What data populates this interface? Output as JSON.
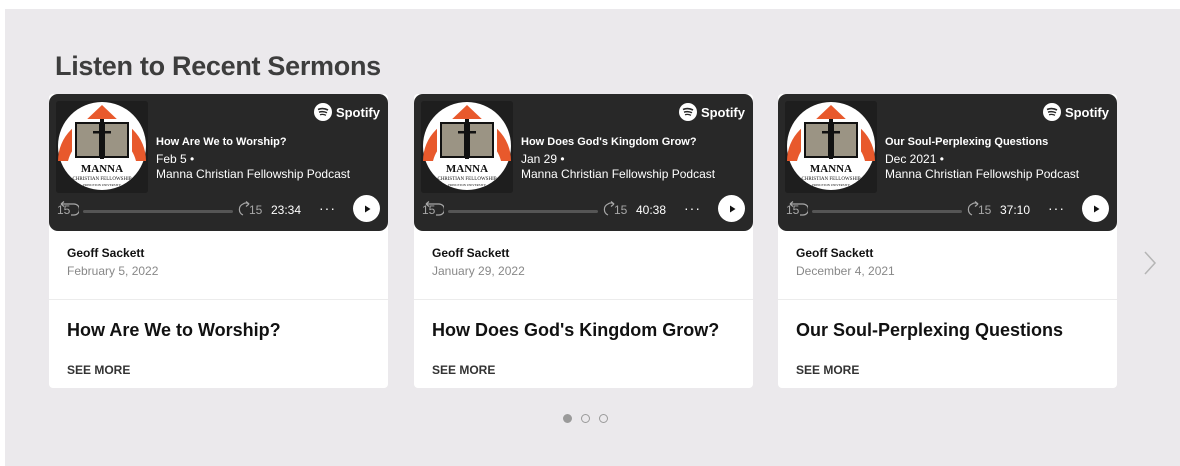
{
  "section": {
    "title": "Listen to Recent Sermons"
  },
  "cover_art": {
    "name_line": "MANNA",
    "sub_line": "CHRISTIAN FELLOWSHIP",
    "small_line": "PRINCETON UNIVERSITY",
    "colors": {
      "orange": "#e8592c",
      "book": "#9b9484"
    }
  },
  "spotify": {
    "label": "Spotify"
  },
  "cards": [
    {
      "player": {
        "episode_title": "How Are We to Worship?",
        "date": "Feb 5 •",
        "show": "Manna Christian Fellowship Podcast",
        "skip_back": "15",
        "skip_forward": "15",
        "duration": "23:34",
        "more": "···"
      },
      "author": "Geoff Sackett",
      "date": "February 5, 2022",
      "title": "How Are We to Worship?",
      "see_more": "SEE MORE"
    },
    {
      "player": {
        "episode_title": "How Does God's Kingdom Grow?",
        "date": "Jan 29 •",
        "show": "Manna Christian Fellowship Podcast",
        "skip_back": "15",
        "skip_forward": "15",
        "duration": "40:38",
        "more": "···"
      },
      "author": "Geoff Sackett",
      "date": "January 29, 2022",
      "title": "How Does God's Kingdom Grow?",
      "see_more": "SEE MORE"
    },
    {
      "player": {
        "episode_title": "Our Soul-Perplexing Questions",
        "date": "Dec 2021 •",
        "show": "Manna Christian Fellowship Podcast",
        "skip_back": "15",
        "skip_forward": "15",
        "duration": "37:10",
        "more": "···"
      },
      "author": "Geoff Sackett",
      "date": "December 4, 2021",
      "title": "Our Soul-Perplexing Questions",
      "see_more": "SEE MORE"
    }
  ],
  "carousel": {
    "active_page": 1,
    "page_count": 3,
    "next_icon": "chevron-right-icon"
  }
}
